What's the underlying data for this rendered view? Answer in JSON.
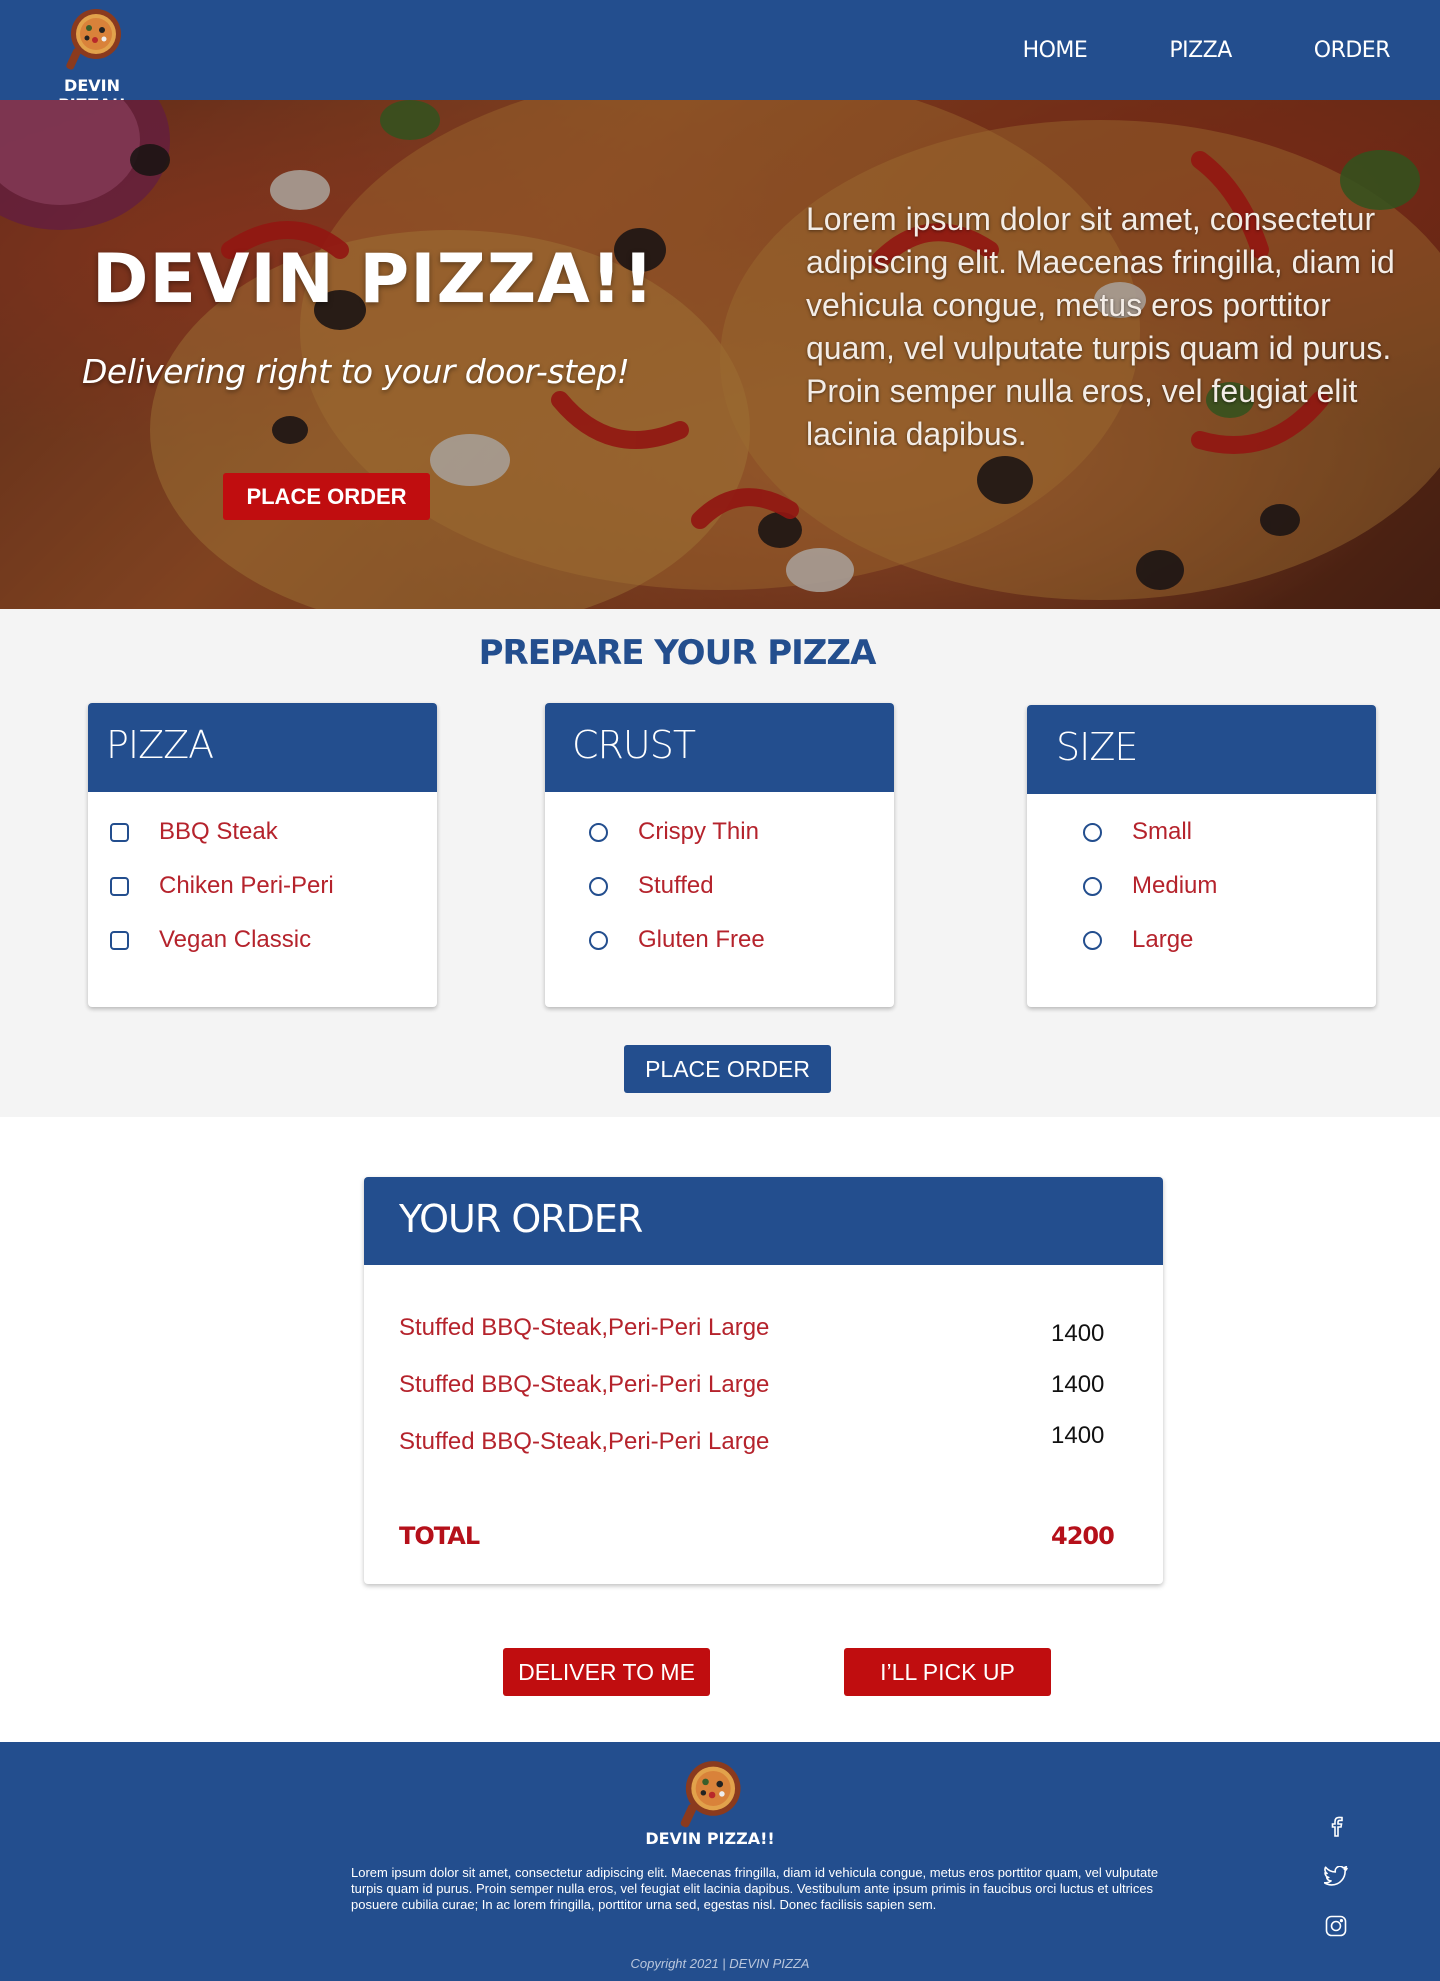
{
  "brand": {
    "name": "DEVIN PIZZA!!"
  },
  "nav": {
    "home": "HOME",
    "pizza": "PIZZA",
    "order": "ORDER"
  },
  "hero": {
    "title": "DEVIN PIZZA!!",
    "subtitle": "Delivering right to your door-step!",
    "button": "PLACE ORDER",
    "paragraph": "Lorem ipsum dolor sit amet, consectetur adipiscing elit. Maecenas fringilla, diam id vehicula congue, metus eros porttitor quam, vel vulputate turpis quam id purus. Proin semper nulla eros, vel feugiat elit lacinia dapibus."
  },
  "prepare": {
    "title": "PREPARE YOUR PIZZA",
    "pizza": {
      "heading": "PIZZA",
      "options": [
        "BBQ Steak",
        "Chiken Peri-Peri",
        "Vegan Classic"
      ]
    },
    "crust": {
      "heading": "CRUST",
      "options": [
        "Crispy Thin",
        "Stuffed",
        "Gluten Free"
      ]
    },
    "size": {
      "heading": "SIZE",
      "options": [
        "Small",
        "Medium",
        "Large"
      ]
    },
    "button": "PLACE ORDER"
  },
  "order": {
    "heading": "YOUR ORDER",
    "items": [
      {
        "name": "Stuffed BBQ-Steak,Peri-Peri Large",
        "price": "1400"
      },
      {
        "name": "Stuffed BBQ-Steak,Peri-Peri Large",
        "price": "1400"
      },
      {
        "name": "Stuffed BBQ-Steak,Peri-Peri Large",
        "price": "1400"
      }
    ],
    "total_label": "TOTAL",
    "total_value": "4200"
  },
  "actions": {
    "deliver": "DELIVER TO ME",
    "pickup": "I’LL PICK UP"
  },
  "footer": {
    "brand": "DEVIN PIZZA!!",
    "paragraph": "Lorem ipsum dolor sit amet, consectetur adipiscing elit. Maecenas fringilla, diam id vehicula congue, metus eros porttitor quam, vel vulputate turpis quam id purus. Proin semper nulla eros, vel feugiat elit lacinia dapibus. Vestibulum ante ipsum primis in faucibus orci luctus et ultrices posuere cubilia curae; In ac lorem fringilla, porttitor urna sed, egestas nisl. Donec facilisis sapien sem.",
    "copyright": "Copyright 2021 | DEVIN PIZZA",
    "social": [
      "facebook-icon",
      "twitter-icon",
      "instagram-icon"
    ]
  },
  "colors": {
    "primary": "#234e8e",
    "accent": "#c00d0f",
    "option_text": "#b5232c",
    "section_bg": "#f4f4f4"
  }
}
